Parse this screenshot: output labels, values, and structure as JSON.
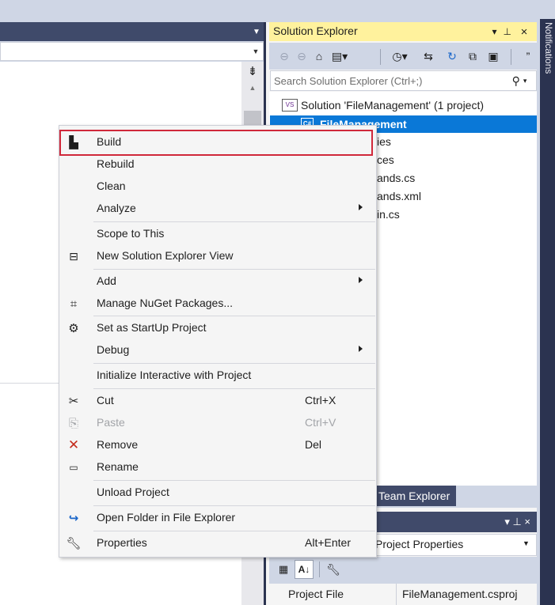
{
  "editor": {
    "split_glyph": "⇟"
  },
  "solution_explorer": {
    "title": "Solution Explorer",
    "pin_glyph": "▾ ⊥",
    "close_glyph": "×",
    "toolbar_icons": [
      "back-icon",
      "forward-icon",
      "home-icon",
      "switch-views-icon",
      "pending-changes-icon",
      "sync-icon",
      "refresh-icon",
      "collapse-all-icon",
      "show-all-files-icon",
      "more-icon"
    ],
    "search_placeholder": "Search Solution Explorer (Ctrl+;)",
    "tree": {
      "solution": "Solution 'FileManagement' (1 project)",
      "project": "FileManagement",
      "items": [
        "ies",
        "ces",
        "ands.cs",
        "ands.xml",
        "in.cs"
      ]
    }
  },
  "tabs": {
    "team_explorer": "Team Explorer"
  },
  "properties": {
    "object_label": "Project Properties",
    "controls": "▾  ⊥  ×",
    "row_key": "Project File",
    "row_value": "FileManagement.csproj"
  },
  "notifications": {
    "label": "Notifications"
  },
  "context_menu": {
    "items": [
      {
        "label": "Build",
        "icon": "build-icon"
      },
      {
        "label": "Rebuild"
      },
      {
        "label": "Clean"
      },
      {
        "label": "Analyze",
        "submenu": true
      },
      {
        "label": "Scope to This"
      },
      {
        "label": "New Solution Explorer View",
        "icon": "new-view-icon"
      },
      {
        "label": "Add",
        "submenu": true
      },
      {
        "label": "Manage NuGet Packages...",
        "icon": "nuget-icon"
      },
      {
        "label": "Set as StartUp Project",
        "icon": "gear-icon"
      },
      {
        "label": "Debug",
        "submenu": true
      },
      {
        "label": "Initialize Interactive with Project"
      },
      {
        "label": "Cut",
        "shortcut": "Ctrl+X",
        "icon": "scissors-icon"
      },
      {
        "label": "Paste",
        "shortcut": "Ctrl+V",
        "icon": "paste-icon",
        "disabled": true
      },
      {
        "label": "Remove",
        "shortcut": "Del",
        "icon": "remove-icon"
      },
      {
        "label": "Rename",
        "icon": "rename-icon"
      },
      {
        "label": "Unload Project"
      },
      {
        "label": "Open Folder in File Explorer",
        "icon": "open-folder-icon"
      },
      {
        "label": "Properties",
        "shortcut": "Alt+Enter",
        "icon": "wrench-icon"
      }
    ]
  },
  "colors": {
    "accent_tab": "#fff29d",
    "selection": "#0a78d7",
    "highlight_border": "#d0283a",
    "dark_chrome": "#404a6a"
  }
}
